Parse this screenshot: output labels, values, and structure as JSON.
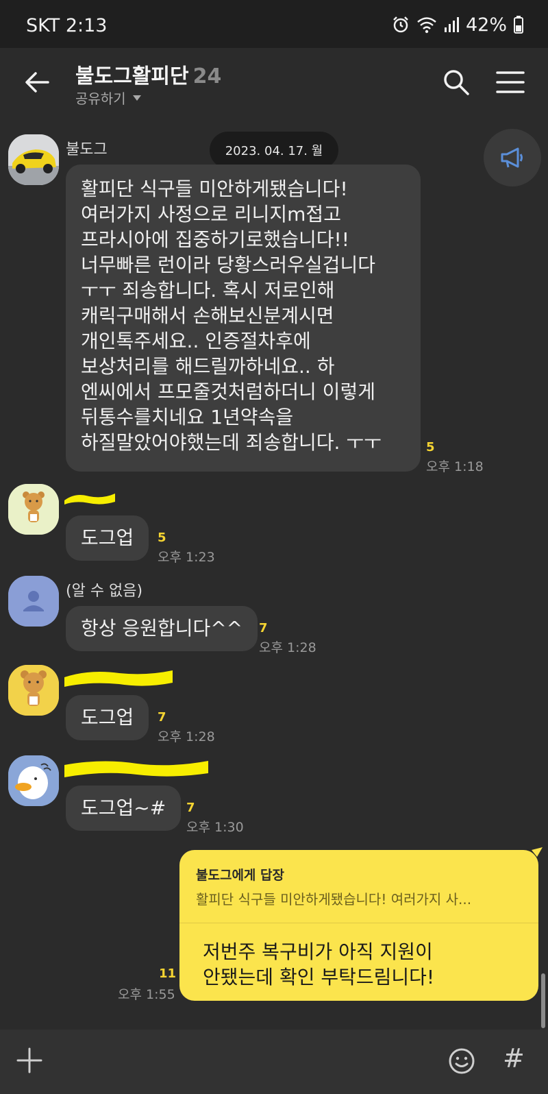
{
  "status_bar": {
    "carrier_time": "SKT 2:13",
    "battery": "42%"
  },
  "header": {
    "title": "불도그활피단",
    "member_count": "24",
    "subtitle": "공유하기"
  },
  "date_divider": "2023. 04. 17. 월",
  "messages": [
    {
      "sender": "불도그",
      "lines": [
        "활피단 식구들 미안하게됐습니다!",
        "여러가지 사정으로 리니지m접고",
        "프라시아에 집중하기로했습니다!!",
        "너무빠른 런이라 당황스러우실겁니다",
        "ㅜㅜ 죄송합니다. 혹시 저로인해",
        "캐릭구매해서 손해보신분계시면",
        "개인톡주세요.. 인증절차후에",
        "보상처리를 해드릴까하네요.. 하",
        "엔씨에서 프모줄것처럼하더니 이렇게",
        "뒤통수를치네요 1년약속을",
        "하질말았어야했는데 죄송합니다. ㅜㅜ"
      ],
      "unread": "5",
      "time": "오후 1:18"
    },
    {
      "sender": "",
      "text": "도그업",
      "unread": "5",
      "time": "오후 1:23"
    },
    {
      "sender": "(알 수 없음)",
      "text": "항상 응원합니다^^",
      "unread": "7",
      "time": "오후 1:28"
    },
    {
      "sender": "",
      "text": "도그업",
      "unread": "7",
      "time": "오후 1:28"
    },
    {
      "sender": "",
      "text": "도그업~#",
      "unread": "7",
      "time": "오후 1:30"
    }
  ],
  "my_reply": {
    "reply_header": "불도그에게 답장",
    "quoted": "활피단 식구들 미안하게됐습니다! 여러가지 사...",
    "line1": "저번주 복구비가 아직 지원이",
    "line2": "안됐는데 확인 부탁드림니다!",
    "unread": "11",
    "time": "오후 1:55"
  },
  "icons": [
    "back-arrow-icon",
    "search-icon",
    "menu-icon",
    "megaphone-icon",
    "plus-icon",
    "emoji-icon",
    "hash-icon",
    "alarm-icon",
    "wifi-icon",
    "signal-icon",
    "battery-icon"
  ],
  "colors": {
    "background": "#2b2b2b",
    "bubble": "#3e3e3e",
    "my_bubble": "#fbe44d",
    "unread": "#f5d432",
    "redaction": "#f7ee00"
  }
}
